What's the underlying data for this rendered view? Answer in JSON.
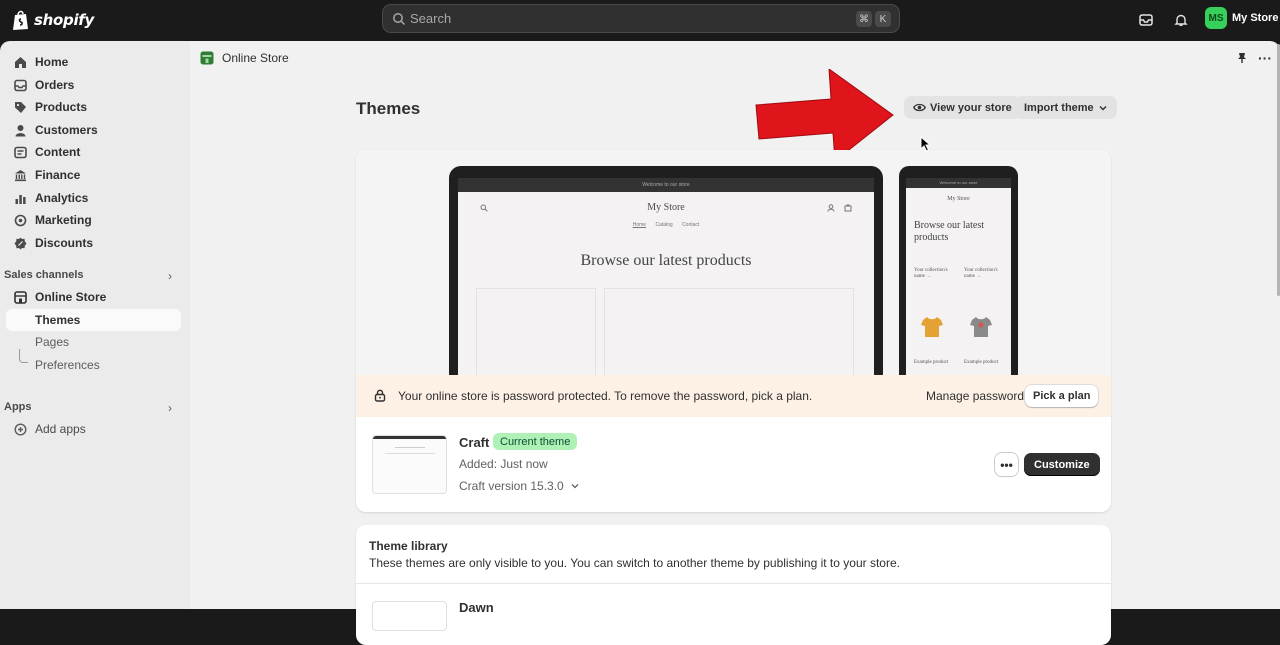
{
  "topbar": {
    "brand": "shopify",
    "search_placeholder": "Search",
    "shortcut_keys": [
      "⌘",
      "K"
    ],
    "store_initials": "MS",
    "store_name": "My Store"
  },
  "sidebar": {
    "items": [
      {
        "label": "Home",
        "icon": "home-icon"
      },
      {
        "label": "Orders",
        "icon": "orders-icon"
      },
      {
        "label": "Products",
        "icon": "tag-icon"
      },
      {
        "label": "Customers",
        "icon": "person-icon"
      },
      {
        "label": "Content",
        "icon": "content-icon"
      },
      {
        "label": "Finance",
        "icon": "bank-icon"
      },
      {
        "label": "Analytics",
        "icon": "chart-icon"
      },
      {
        "label": "Marketing",
        "icon": "target-icon"
      },
      {
        "label": "Discounts",
        "icon": "discount-icon"
      }
    ],
    "sales_channels_label": "Sales channels",
    "online_store": "Online Store",
    "sub_items": [
      "Themes",
      "Pages",
      "Preferences"
    ],
    "apps_label": "Apps",
    "add_apps": "Add apps"
  },
  "header": {
    "breadcrumb": "Online Store",
    "title": "Themes",
    "view_store": "View your store",
    "import_theme": "Import theme"
  },
  "preview": {
    "announcement": "Welcome to our store",
    "store_name": "My Store",
    "nav": [
      "Home",
      "Catalog",
      "Contact"
    ],
    "hero": "Browse our latest products",
    "phone_collections": [
      "Your collection's name →",
      "Your collection's name →"
    ],
    "phone_products": [
      "Example product",
      "Example product"
    ]
  },
  "notice": {
    "message": "Your online store is password protected. To remove the password, pick a plan.",
    "manage": "Manage password",
    "pick_plan": "Pick a plan"
  },
  "current_theme": {
    "name": "Craft",
    "badge": "Current theme",
    "added": "Added: Just now",
    "version": "Craft version 15.3.0",
    "more": "•••",
    "customize": "Customize"
  },
  "library": {
    "title": "Theme library",
    "description": "These themes are only visible to you. You can switch to another theme by publishing it to your store.",
    "first_theme": "Dawn"
  },
  "colors": {
    "topbar": "#1a1a1a",
    "sidebar": "#ebebeb",
    "main": "#f1f1f1",
    "badge_bg": "#aff0b5",
    "notice_bg": "#fdf1e5",
    "arrow": "#e0141b"
  }
}
